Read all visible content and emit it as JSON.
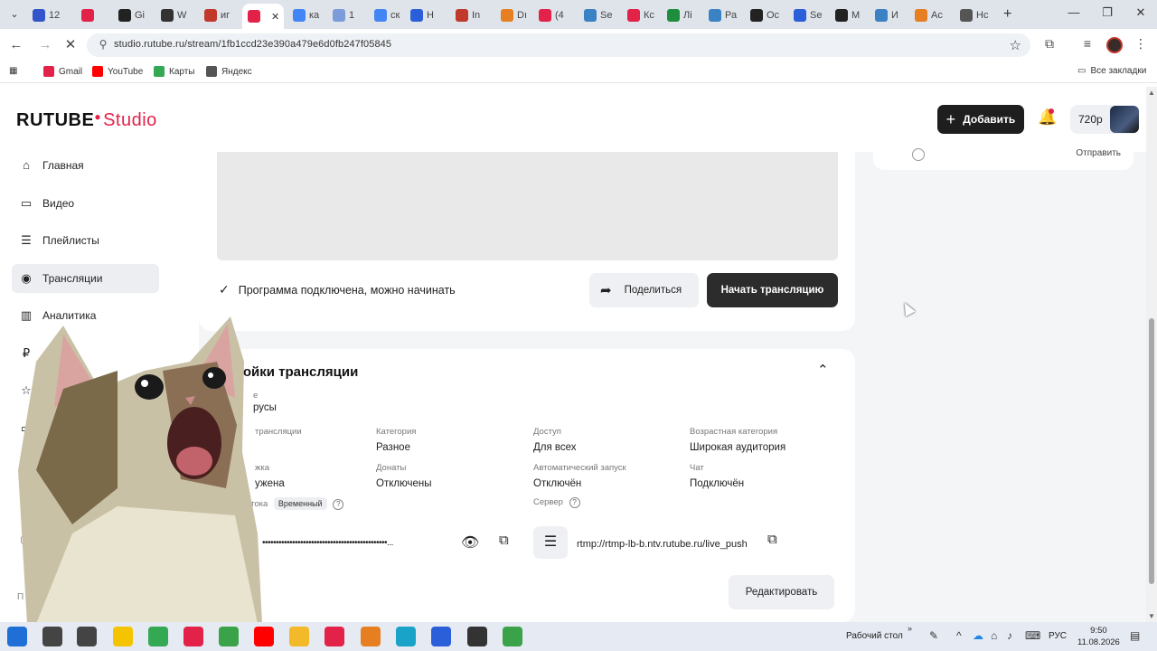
{
  "browser": {
    "tabs": [
      {
        "label": "12",
        "color": "#3355cc"
      },
      {
        "label": "",
        "color": "#e3224a"
      },
      {
        "label": "Gi",
        "color": "#222222"
      },
      {
        "label": "W",
        "color": "#333333"
      },
      {
        "label": "иг",
        "color": "#c0392b"
      },
      {
        "label": "",
        "color": "#e3224a",
        "active": true
      },
      {
        "label": "ка",
        "color": "#4285f4"
      },
      {
        "label": "1",
        "color": "#7b9cd9"
      },
      {
        "label": "ск",
        "color": "#4285f4"
      },
      {
        "label": "Н",
        "color": "#2b5fd9"
      },
      {
        "label": "In",
        "color": "#c0392b"
      },
      {
        "label": "Dı",
        "color": "#e67e22"
      },
      {
        "label": "(4",
        "color": "#e3224a"
      },
      {
        "label": "Se",
        "color": "#3b82c4"
      },
      {
        "label": "Кс",
        "color": "#e3224a"
      },
      {
        "label": "Лі",
        "color": "#1e8e3e"
      },
      {
        "label": "Ра",
        "color": "#3b82c4"
      },
      {
        "label": "Ос",
        "color": "#222222"
      },
      {
        "label": "Se",
        "color": "#2b5fd9"
      },
      {
        "label": "М",
        "color": "#222222"
      },
      {
        "label": "И",
        "color": "#3b82c4"
      },
      {
        "label": "Ас",
        "color": "#e67e22"
      },
      {
        "label": "Нс",
        "color": "#555555"
      }
    ],
    "url": "studio.rutube.ru/stream/1fb1ccd23e390a479e6d0fb247f05845",
    "bookmarks": [
      {
        "label": "Gmail",
        "color": "#e3224a"
      },
      {
        "label": "YouTube",
        "color": "#ff0000"
      },
      {
        "label": "Карты",
        "color": "#34a853"
      },
      {
        "label": "Яндекс",
        "color": "#555555"
      }
    ],
    "all_bookmarks": "Все закладки"
  },
  "app": {
    "logo_main": "RUTUBE",
    "logo_studio": "Studio",
    "add_label": "Добавить",
    "quality": "720p"
  },
  "sidebar": {
    "items": [
      {
        "label": "Главная",
        "icon": "home-icon",
        "glyph": "⌂"
      },
      {
        "label": "Видео",
        "icon": "video-icon",
        "glyph": "▭"
      },
      {
        "label": "Плейлисты",
        "icon": "playlist-icon",
        "glyph": "☰"
      },
      {
        "label": "Трансляции",
        "icon": "broadcast-icon",
        "glyph": "◉",
        "active": true
      },
      {
        "label": "Аналитика",
        "icon": "analytics-icon",
        "glyph": "▥"
      },
      {
        "label": "",
        "icon": "ruble-icon",
        "glyph": "₽"
      },
      {
        "label": "Уро",
        "icon": "star-icon",
        "glyph": "☆"
      },
      {
        "label": "Донат",
        "icon": "donate-icon",
        "glyph": "▭"
      },
      {
        "label": "Коммента",
        "icon": "comments-icon",
        "glyph": "▢"
      },
      {
        "label": "Настро",
        "icon": "settings-icon",
        "glyph": "⚙"
      },
      {
        "label": "Спр",
        "icon": "info-icon",
        "glyph": "ⓘ"
      }
    ],
    "footer": "П"
  },
  "stream": {
    "status": "Программа подключена, можно начинать",
    "share_label": "Поделиться",
    "start_label": "Начать трансляцию"
  },
  "settings": {
    "title": "стройки трансляции",
    "field_top_label": "е",
    "field_top_value": "русы",
    "type_label": "трансляции",
    "category_label": "Категория",
    "category_value": "Разное",
    "access_label": "Доступ",
    "access_value": "Для всех",
    "age_label": "Возрастная категория",
    "age_value": "Широкая аудитория",
    "record_label": "жка",
    "record_value": "ужена",
    "donate_label": "Донаты",
    "donate_value": "Отключены",
    "autostart_label": "Автоматический запуск",
    "autostart_value": "Отключён",
    "chat_label": "Чат",
    "chat_value": "Подключён",
    "key_label": "отока",
    "key_badge": "Временный",
    "key_value": "••••••••••••••••••••••••••••••••••••••••••••••...",
    "server_label": "Сервер",
    "server_value": "rtmp://rtmp-lb-b.ntv.rutube.ru/live_push",
    "edit_label": "Редактировать"
  },
  "right_panel": {
    "send_label": "Отправить"
  },
  "taskbar": {
    "desktop_label": "Рабочий стол",
    "lang": "РУС",
    "time": "9:50",
    "date": "11.08.2026",
    "apps": [
      {
        "name": "windows-start-icon",
        "color": "#1f6fd6"
      },
      {
        "name": "search-icon",
        "color": "#444444"
      },
      {
        "name": "task-view-icon",
        "color": "#444444"
      },
      {
        "name": "yandex-browser-icon",
        "color": "#f5c400"
      },
      {
        "name": "chrome-icon",
        "color": "#34a853"
      },
      {
        "name": "yandex-icon",
        "color": "#e3224a"
      },
      {
        "name": "utorrent-icon",
        "color": "#3aa34a"
      },
      {
        "name": "youtube-icon",
        "color": "#ff0000"
      },
      {
        "name": "explorer-icon",
        "color": "#f2b929"
      },
      {
        "name": "wps-icon",
        "color": "#e3224a"
      },
      {
        "name": "app-icon",
        "color": "#e67e22"
      },
      {
        "name": "vpn-icon",
        "color": "#1aa3c9"
      },
      {
        "name": "screen-icon",
        "color": "#2b5fd9"
      },
      {
        "name": "obs-icon",
        "color": "#333333"
      },
      {
        "name": "gaming-icon",
        "color": "#3aa34a"
      }
    ]
  }
}
